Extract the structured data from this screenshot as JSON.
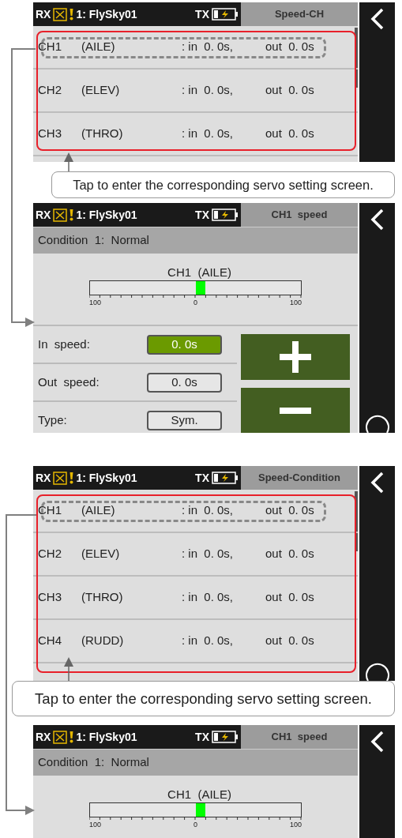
{
  "panels": [
    {
      "kind": "list_screen",
      "framed": true,
      "header": {
        "rx": "RX",
        "model": "1: FlySky01",
        "tx": "TX",
        "title": "Speed-CH"
      },
      "rows": [
        {
          "channel": "CH1",
          "name": "(AILE)",
          "in": ": in  0. 0s,",
          "out": "out  0. 0s",
          "highlighted": true
        },
        {
          "channel": "CH2",
          "name": "(ELEV)",
          "in": ": in  0. 0s,",
          "out": "out  0. 0s",
          "highlighted": false
        },
        {
          "channel": "CH3",
          "name": "(THRO)",
          "in": ": in  0. 0s,",
          "out": "out  0. 0s",
          "highlighted": false
        }
      ]
    },
    {
      "kind": "callout",
      "text": "Tap to enter the corresponding servo setting screen."
    },
    {
      "kind": "detail_screen",
      "header": {
        "rx": "RX",
        "model": "1: FlySky01",
        "tx": "TX",
        "title": "CH1  speed"
      },
      "condition": "Condition  1:  Normal",
      "meter": {
        "label": "CH1  (AILE)",
        "level": 0.5,
        "scale": [
          "100",
          "0",
          "100"
        ]
      },
      "fields": [
        {
          "label": "In  speed:",
          "value": "0. 0s",
          "selected": true
        },
        {
          "label": "Out  speed:",
          "value": "0. 0s",
          "selected": false
        },
        {
          "label": "Type:",
          "value": "Sym.",
          "selected": false
        }
      ],
      "buttons": [
        {
          "kind": "plus"
        },
        {
          "kind": "minus"
        }
      ]
    },
    {
      "kind": "list_screen",
      "framed": true,
      "header": {
        "rx": "RX",
        "model": "1: FlySky01",
        "tx": "TX",
        "title": "Speed-Condition"
      },
      "rows": [
        {
          "channel": "CH1",
          "name": "(AILE)",
          "in": ": in  0. 0s,",
          "out": "out  0. 0s",
          "highlighted": true
        },
        {
          "channel": "CH2",
          "name": "(ELEV)",
          "in": ": in  0. 0s,",
          "out": "out  0. 0s",
          "highlighted": false
        },
        {
          "channel": "CH3",
          "name": "(THRO)",
          "in": ": in  0. 0s,",
          "out": "out  0. 0s",
          "highlighted": false
        },
        {
          "channel": "CH4",
          "name": "(RUDD)",
          "in": ": in  0. 0s,",
          "out": "out  0. 0s",
          "highlighted": false
        }
      ],
      "refresh_icon": true
    },
    {
      "kind": "callout",
      "text": "Tap to enter the corresponding servo setting screen."
    },
    {
      "kind": "detail_screen",
      "header": {
        "rx": "RX",
        "model": "1: FlySky01",
        "tx": "TX",
        "title": "CH1  speed"
      },
      "condition": "Condition  1:  Normal",
      "meter": {
        "label": "CH1  (AILE)",
        "level": 0.5,
        "scale": [
          "100",
          "0",
          "100"
        ]
      }
    }
  ]
}
